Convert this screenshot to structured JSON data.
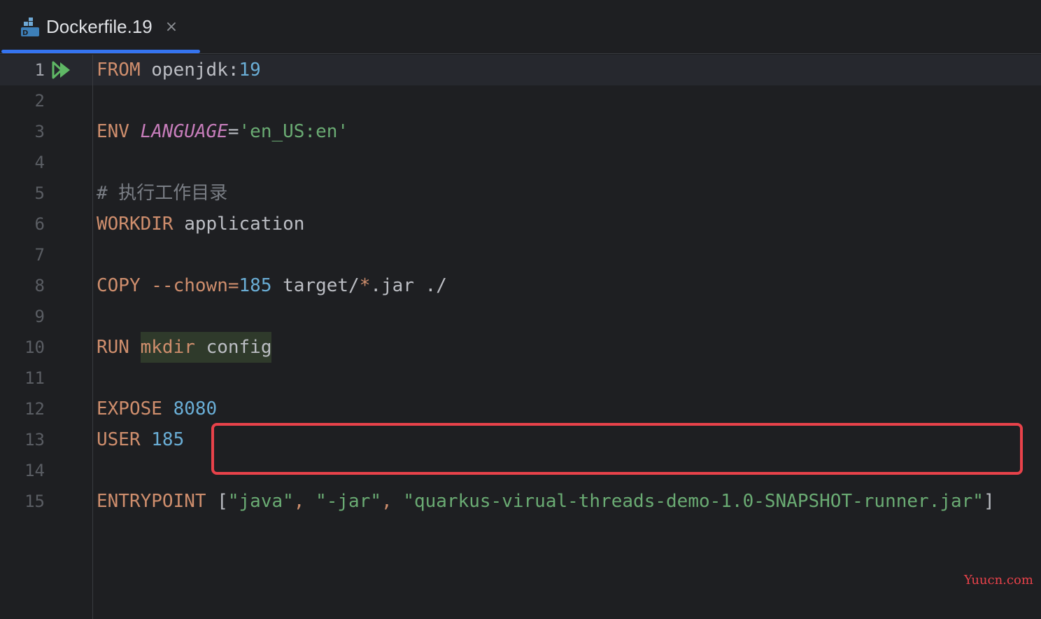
{
  "tab": {
    "title": "Dockerfile.19",
    "close_symbol": "×",
    "icon": "dockerfile-icon"
  },
  "lines": [
    {
      "n": "1"
    },
    {
      "n": "2"
    },
    {
      "n": "3"
    },
    {
      "n": "4"
    },
    {
      "n": "5"
    },
    {
      "n": "6"
    },
    {
      "n": "7"
    },
    {
      "n": "8"
    },
    {
      "n": "9"
    },
    {
      "n": "10"
    },
    {
      "n": "11"
    },
    {
      "n": "12"
    },
    {
      "n": "13"
    },
    {
      "n": "14"
    },
    {
      "n": "15"
    }
  ],
  "code": {
    "l1": {
      "kw": "FROM",
      "image": "openjdk",
      "colon": ":",
      "tag": "19"
    },
    "l3": {
      "kw": "ENV",
      "name": "LANGUAGE",
      "eq": "=",
      "value": "'en_US:en'"
    },
    "l5": {
      "comment": "# 执行工作目录"
    },
    "l6": {
      "kw": "WORKDIR",
      "arg": "application"
    },
    "l8": {
      "kw": "COPY",
      "flag": "--chown=",
      "uid": "185",
      "src_a": "target/",
      "star": "*",
      "src_b": ".jar ./"
    },
    "l10": {
      "kw": "RUN",
      "cmd": "mkdir",
      "arg": "config"
    },
    "l12": {
      "kw": "EXPOSE",
      "port": "8080"
    },
    "l13": {
      "kw": "USER",
      "uid": "185"
    },
    "l15": {
      "kw": "ENTRYPOINT",
      "open": "[",
      "s1": "\"java\"",
      "c1": ", ",
      "s2": "\"-jar\"",
      "c2": ", ",
      "s3": "\"quarkus-virual-threads-demo-1.0-SNAPSHOT-runner.jar\"",
      "close": "]"
    }
  },
  "watermark": "Yuucn.com",
  "colors": {
    "keyword": "#cf8e6d",
    "number": "#6aaed6",
    "string": "#6aab73",
    "env_var": "#c77dbb",
    "highlight_box": "#e8424a",
    "tab_accent": "#3574f0",
    "run_icon": "#5fb865"
  }
}
